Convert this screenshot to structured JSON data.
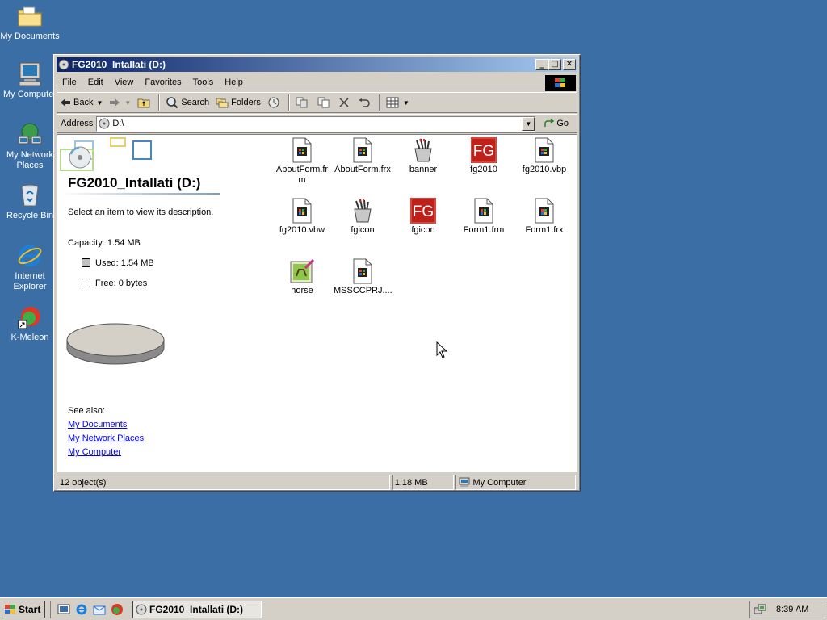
{
  "desktop": {
    "icons": [
      {
        "label": "My Documents",
        "icon": "folder-documents-icon"
      },
      {
        "label": "My Computer",
        "icon": "computer-icon"
      },
      {
        "label_line1": "My Network",
        "label_line2": "Places",
        "icon": "network-places-icon"
      },
      {
        "label": "Recycle Bin",
        "icon": "recycle-bin-icon"
      },
      {
        "label_line1": "Internet",
        "label_line2": "Explorer",
        "icon": "internet-explorer-icon"
      },
      {
        "label": "K-Meleon",
        "icon": "k-meleon-icon"
      }
    ],
    "background_color": "#3a6ea5"
  },
  "window": {
    "title": "FG2010_Intallati (D:)",
    "title_buttons": {
      "minimize": "_",
      "maximize": "□",
      "close": "✕"
    },
    "menu": [
      "File",
      "Edit",
      "View",
      "Favorites",
      "Tools",
      "Help"
    ],
    "toolbar": {
      "back": "Back",
      "search": "Search",
      "folders": "Folders"
    },
    "address": {
      "label": "Address",
      "value": "D:\\",
      "go": "Go"
    },
    "left_pane": {
      "title": "FG2010_Intallati (D:)",
      "description": "Select an item to view its description.",
      "capacity": "Capacity: 1.54 MB",
      "used": "Used: 1.54 MB",
      "free": "Free: 0 bytes",
      "used_fraction": 1.0,
      "see_also": "See also:",
      "links": [
        "My Documents",
        "My Network Places",
        "My Computer"
      ]
    },
    "files": [
      {
        "name_line1": "AboutForm.fr",
        "name_line2": "m",
        "icon": "vb-file-icon"
      },
      {
        "name_line1": "AboutForm.frx",
        "name_line2": "",
        "icon": "vb-file-icon"
      },
      {
        "name_line1": "banner",
        "name_line2": "",
        "icon": "paint-bucket-icon"
      },
      {
        "name_line1": "fg2010",
        "name_line2": "",
        "icon": "fg-app-icon"
      },
      {
        "name_line1": "fg2010.vbp",
        "name_line2": "",
        "icon": "vb-file-icon"
      },
      {
        "name_line1": "fg2010.vbw",
        "name_line2": "",
        "icon": "vb-file-icon"
      },
      {
        "name_line1": "fgicon",
        "name_line2": "",
        "icon": "paint-bucket-icon"
      },
      {
        "name_line1": "fgicon",
        "name_line2": "",
        "icon": "fg-app-icon"
      },
      {
        "name_line1": "Form1.frm",
        "name_line2": "",
        "icon": "vb-file-icon"
      },
      {
        "name_line1": "Form1.frx",
        "name_line2": "",
        "icon": "vb-file-icon"
      },
      {
        "name_line1": "horse",
        "name_line2": "",
        "icon": "horse-image-icon"
      },
      {
        "name_line1": "MSSCCPRJ....",
        "name_line2": "",
        "icon": "vb-file-icon"
      }
    ],
    "status": {
      "objects": "12 object(s)",
      "size": "1.18 MB",
      "zone": "My Computer"
    }
  },
  "taskbar": {
    "start": "Start",
    "task": "FG2010_Intallati (D:)",
    "clock": "8:39 AM"
  }
}
